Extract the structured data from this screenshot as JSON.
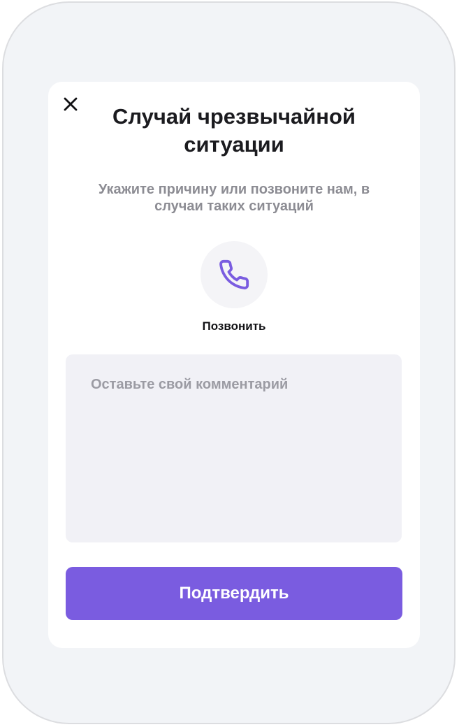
{
  "dialog": {
    "title": "Случай чрезвычайной ситуации",
    "subtitle": "Укажите причину или позвоните нам, в случаи таких ситуаций",
    "close_icon": "close-icon",
    "call": {
      "icon": "phone-icon",
      "label": "Позвонить"
    },
    "comment": {
      "placeholder": "Оставьте свой комментарий",
      "value": ""
    },
    "confirm_label": "Подтвердить"
  },
  "colors": {
    "accent": "#7a5ce0",
    "background": "#f2f4f7",
    "card": "#ffffff",
    "input_bg": "#f1f1f6",
    "muted_text": "#8c8c93"
  }
}
